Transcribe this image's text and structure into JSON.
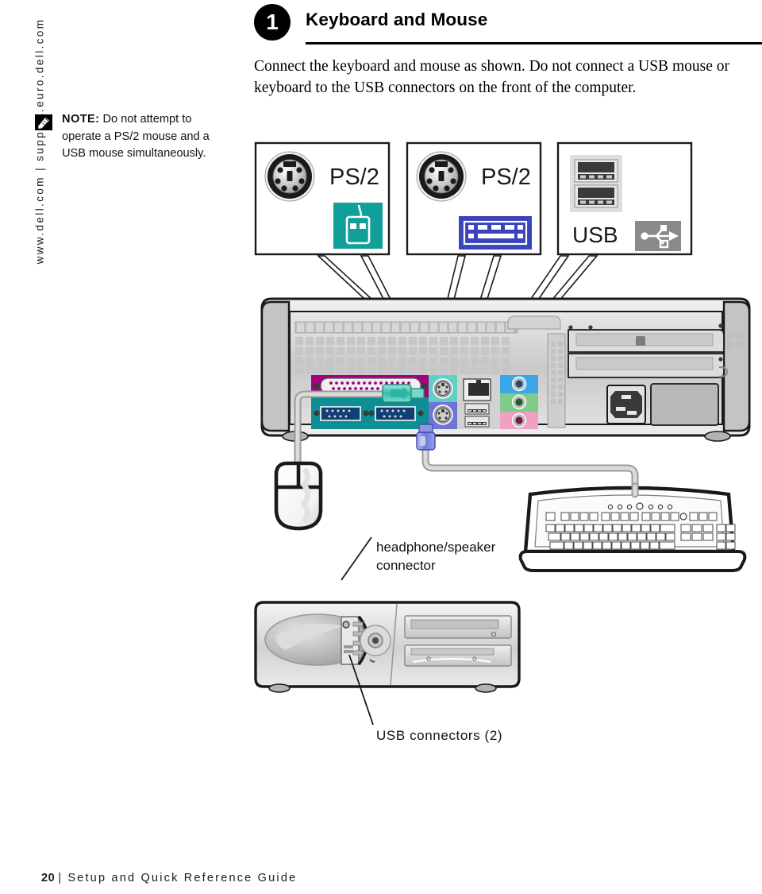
{
  "sidebar": {
    "urls": "www.dell.com | support.euro.dell.com"
  },
  "note": {
    "icon": "pencil-note-icon",
    "label": "NOTE:",
    "body": " Do not attempt to operate a PS/2 mouse and a USB mouse simultaneously."
  },
  "header": {
    "step_number": "1",
    "title": "Keyboard and Mouse"
  },
  "intro": {
    "text": "Connect the keyboard and mouse as shown. Do not connect a USB mouse or keyboard to the USB connectors on the front of the computer."
  },
  "callouts": {
    "ps2_mouse": {
      "label": "PS/2",
      "icon": "mouse-icon",
      "icon_color": "#11a099"
    },
    "ps2_keyboard": {
      "label": "PS/2",
      "icon": "keyboard-icon",
      "icon_color": "#3b44b8"
    },
    "usb": {
      "label": "USB",
      "icon": "usb-trident-icon",
      "icon_color": "#8a8a8a"
    }
  },
  "annotations": {
    "headphone": "headphone/speaker\nconnector",
    "headphone_line1": "headphone/speaker",
    "headphone_line2": "connector",
    "usb_front": "USB connectors (2)"
  },
  "colors": {
    "parallel_port": "#a4007f",
    "serial_port": "#0d8f93",
    "ps2_mouse_port": "#5fd0c4",
    "ps2_keyboard_port": "#6f74d6",
    "audio_line_in": "#3ba7e8",
    "audio_line_out": "#7fcb8a",
    "audio_mic": "#f0a0c0",
    "chassis": "#d9d9d9",
    "outline": "#1a1a1a"
  },
  "footer": {
    "page": "20",
    "separator": "|",
    "title": "Setup and Quick Reference Guide"
  }
}
